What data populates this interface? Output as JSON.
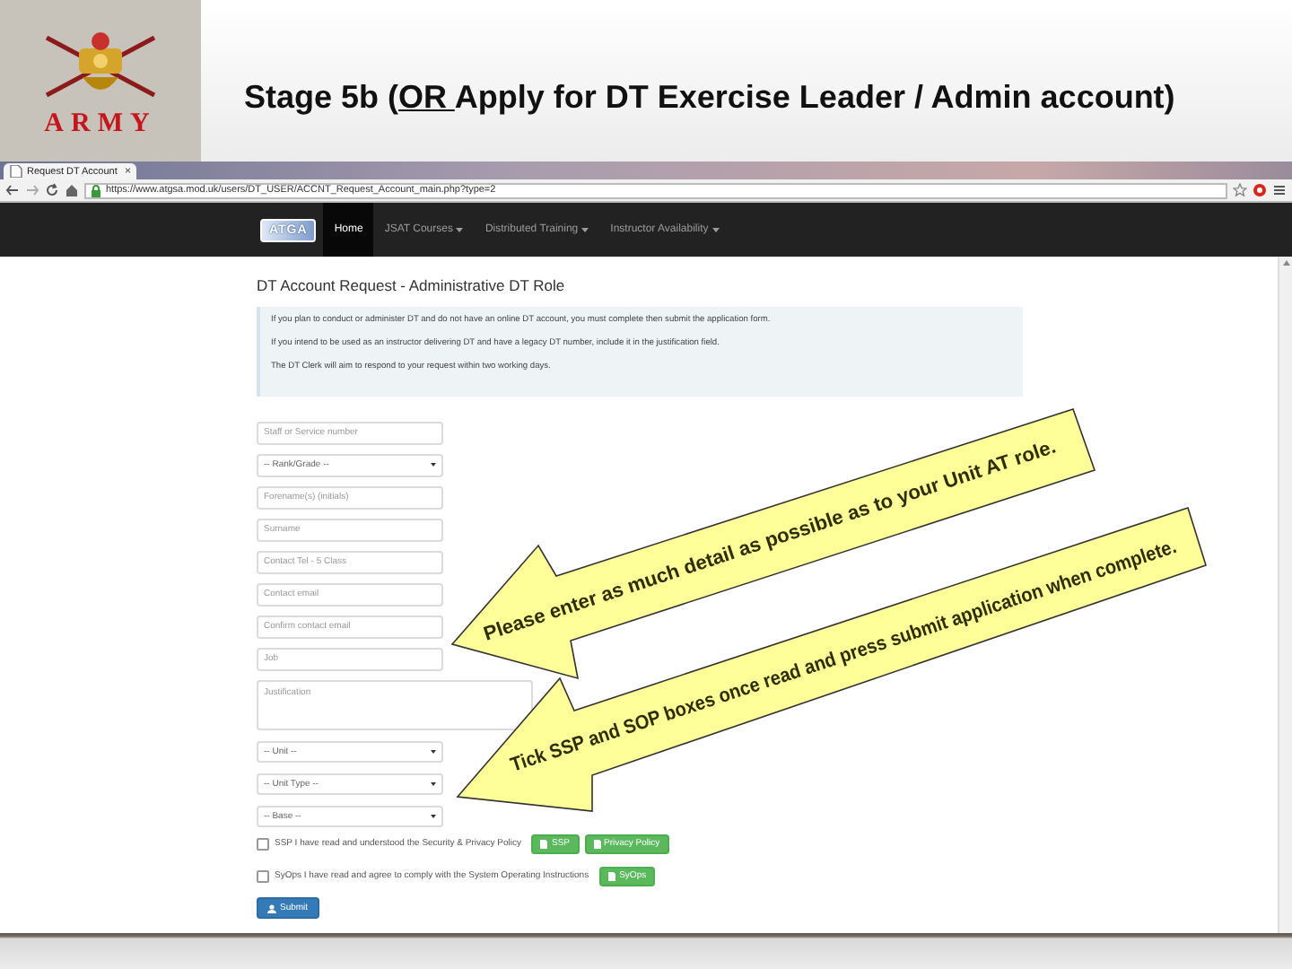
{
  "slide": {
    "logo_text": "ARMY",
    "title_before": "Stage 5b (",
    "title_underlined": "OR ",
    "title_after": "Apply for DT Exercise Leader / Admin account)"
  },
  "browser": {
    "tab_title": "Request DT Account",
    "tab_close": "×",
    "url": "https://www.atgsa.mod.uk/users/DT_USER/ACCNT_Request_Account_main.php?type=2"
  },
  "nav": {
    "logo_text": "ATGA",
    "items": [
      {
        "label": "Home",
        "selected": true,
        "dropdown": false
      },
      {
        "label": "JSAT Courses",
        "selected": false,
        "dropdown": true
      },
      {
        "label": "Distributed Training",
        "selected": false,
        "dropdown": true
      },
      {
        "label": "Instructor Availability",
        "selected": false,
        "dropdown": true
      }
    ]
  },
  "page": {
    "heading": "DT Account Request - Administrative DT Role",
    "info": [
      "If you plan to conduct or administer DT and do not have an online DT account, you must complete then submit the application form.",
      "If you intend to be used as an instructor delivering DT and have a legacy DT number, include it in the justification field.",
      "The DT Clerk will aim to respond to your request within two working days."
    ],
    "fields": [
      {
        "kind": "input",
        "placeholder": "Staff or Service number"
      },
      {
        "kind": "select",
        "value": "-- Rank/Grade --"
      },
      {
        "kind": "input",
        "placeholder": "Forename(s) (initials)"
      },
      {
        "kind": "input",
        "placeholder": "Surname"
      },
      {
        "kind": "input",
        "placeholder": "Contact Tel - 5 Class"
      },
      {
        "kind": "input",
        "placeholder": "Contact email"
      },
      {
        "kind": "input",
        "placeholder": "Confirm contact email"
      },
      {
        "kind": "input",
        "placeholder": "Job"
      },
      {
        "kind": "textarea",
        "placeholder": "Justification"
      },
      {
        "kind": "select",
        "value": "-- Unit --"
      },
      {
        "kind": "select",
        "value": "-- Unit Type --"
      },
      {
        "kind": "select",
        "value": "-- Base --"
      }
    ],
    "checks": [
      {
        "checked": false,
        "label": "SSP I have read and understood the Security & Privacy Policy",
        "buttons": [
          "SSP",
          "Privacy Policy"
        ]
      },
      {
        "checked": false,
        "label": "SyOps I have read and agree to comply with the System Operating Instructions",
        "buttons": [
          "SyOps"
        ]
      }
    ],
    "submit": "Submit"
  },
  "callouts": [
    {
      "text": "Please enter as much detail as possible as to your Unit AT role."
    },
    {
      "text": "Tick SSP and SOP boxes once read and press submit application when complete."
    }
  ]
}
